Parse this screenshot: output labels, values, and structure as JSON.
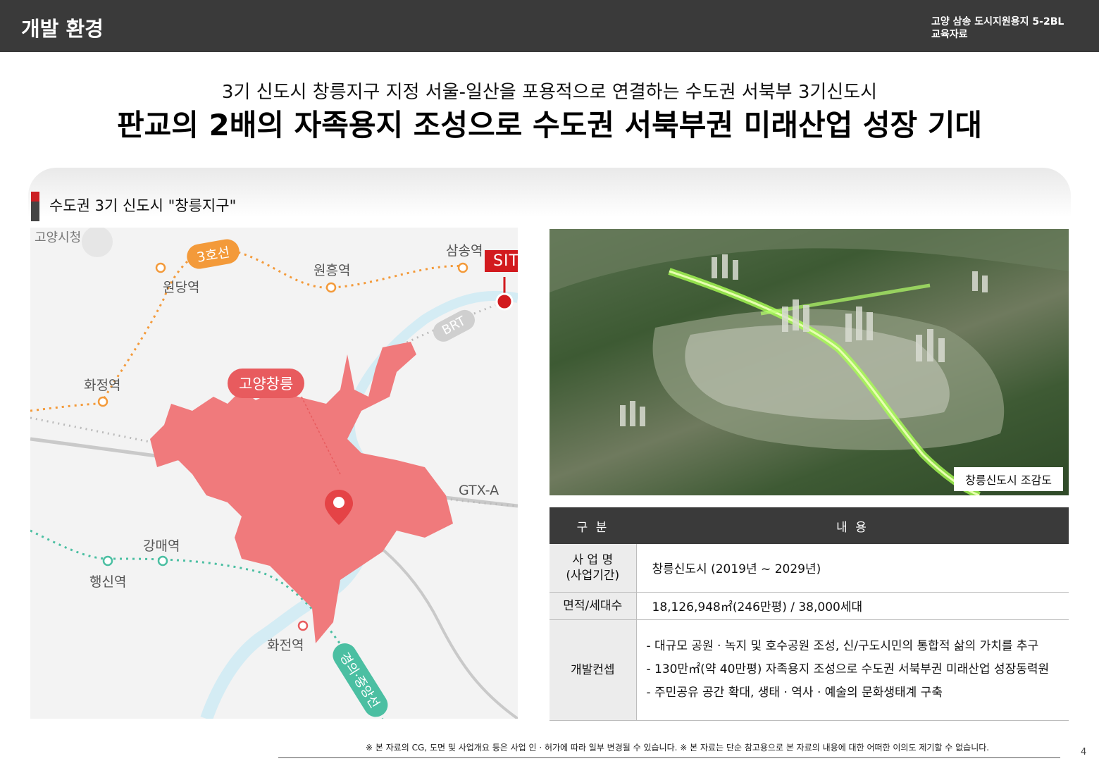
{
  "header": {
    "title": "개발 환경",
    "project_line1": "고양 삼송 도시지원용지 5-2BL",
    "project_line2": "교육자료"
  },
  "headline": {
    "sub": "3기 신도시 창릉지구 지정 서울-일산을 포용적으로 연결하는 수도권 서북부 3기신도시",
    "main": "판교의 2배의 자족용지 조성으로 수도권 서북부권 미래산업 성장 기대"
  },
  "section": {
    "title": "수도권 3기 신도시 \"창릉지구\""
  },
  "map": {
    "labels": {
      "goyang_cityhall": "고양시청",
      "line3": "3호선",
      "samsong": "삼송역",
      "site": "SITE",
      "wonheung": "원흥역",
      "wondang": "원당역",
      "brt": "BRT",
      "hwajeong": "화정역",
      "goyang_changneung": "고양창릉",
      "gtx_a": "GTX-A",
      "gangmae": "강매역",
      "haengsin": "행신역",
      "hwajeon": "화전역",
      "gyeongui": "경의·중앙선"
    },
    "colors": {
      "district": "#f07a7c",
      "line3": "#f39a3a",
      "gyeongui": "#4bbfa2",
      "river": "#cfe9f2",
      "site": "#d21a1e"
    }
  },
  "photo": {
    "caption": "창릉신도시 조감도"
  },
  "table": {
    "header_category": "구 분",
    "header_content": "내 용",
    "row1_label_line1": "사 업 명",
    "row1_label_line2": "(사업기간)",
    "row1_value": "창릉신도시 (2019년 ~ 2029년)",
    "row2_label": "면적/세대수",
    "row2_value": "18,126,948㎡(246만평) / 38,000세대",
    "row3_label": "개발컨셉",
    "row3_items": [
      "- 대규모 공원 · 녹지 및 호수공원 조성, 신/구도시민의 통합적 삶의 가치를 추구",
      "- 130만㎡(약 40만평) 자족용지 조성으로 수도권 서북부권 미래산업 성장동력원",
      "- 주민공유 공간 확대, 생태 · 역사 · 예술의 문화생태계 구축"
    ]
  },
  "footer": {
    "note": "※ 본 자료의 CG, 도면 및 사업개요 등은 사업 인 · 허가에 따라 일부 변경될 수 있습니다.  ※ 본 자료는 단순 참고용으로 본 자료의 내용에 대한 어떠한 이의도 제기할 수 없습니다.",
    "page": "4"
  }
}
